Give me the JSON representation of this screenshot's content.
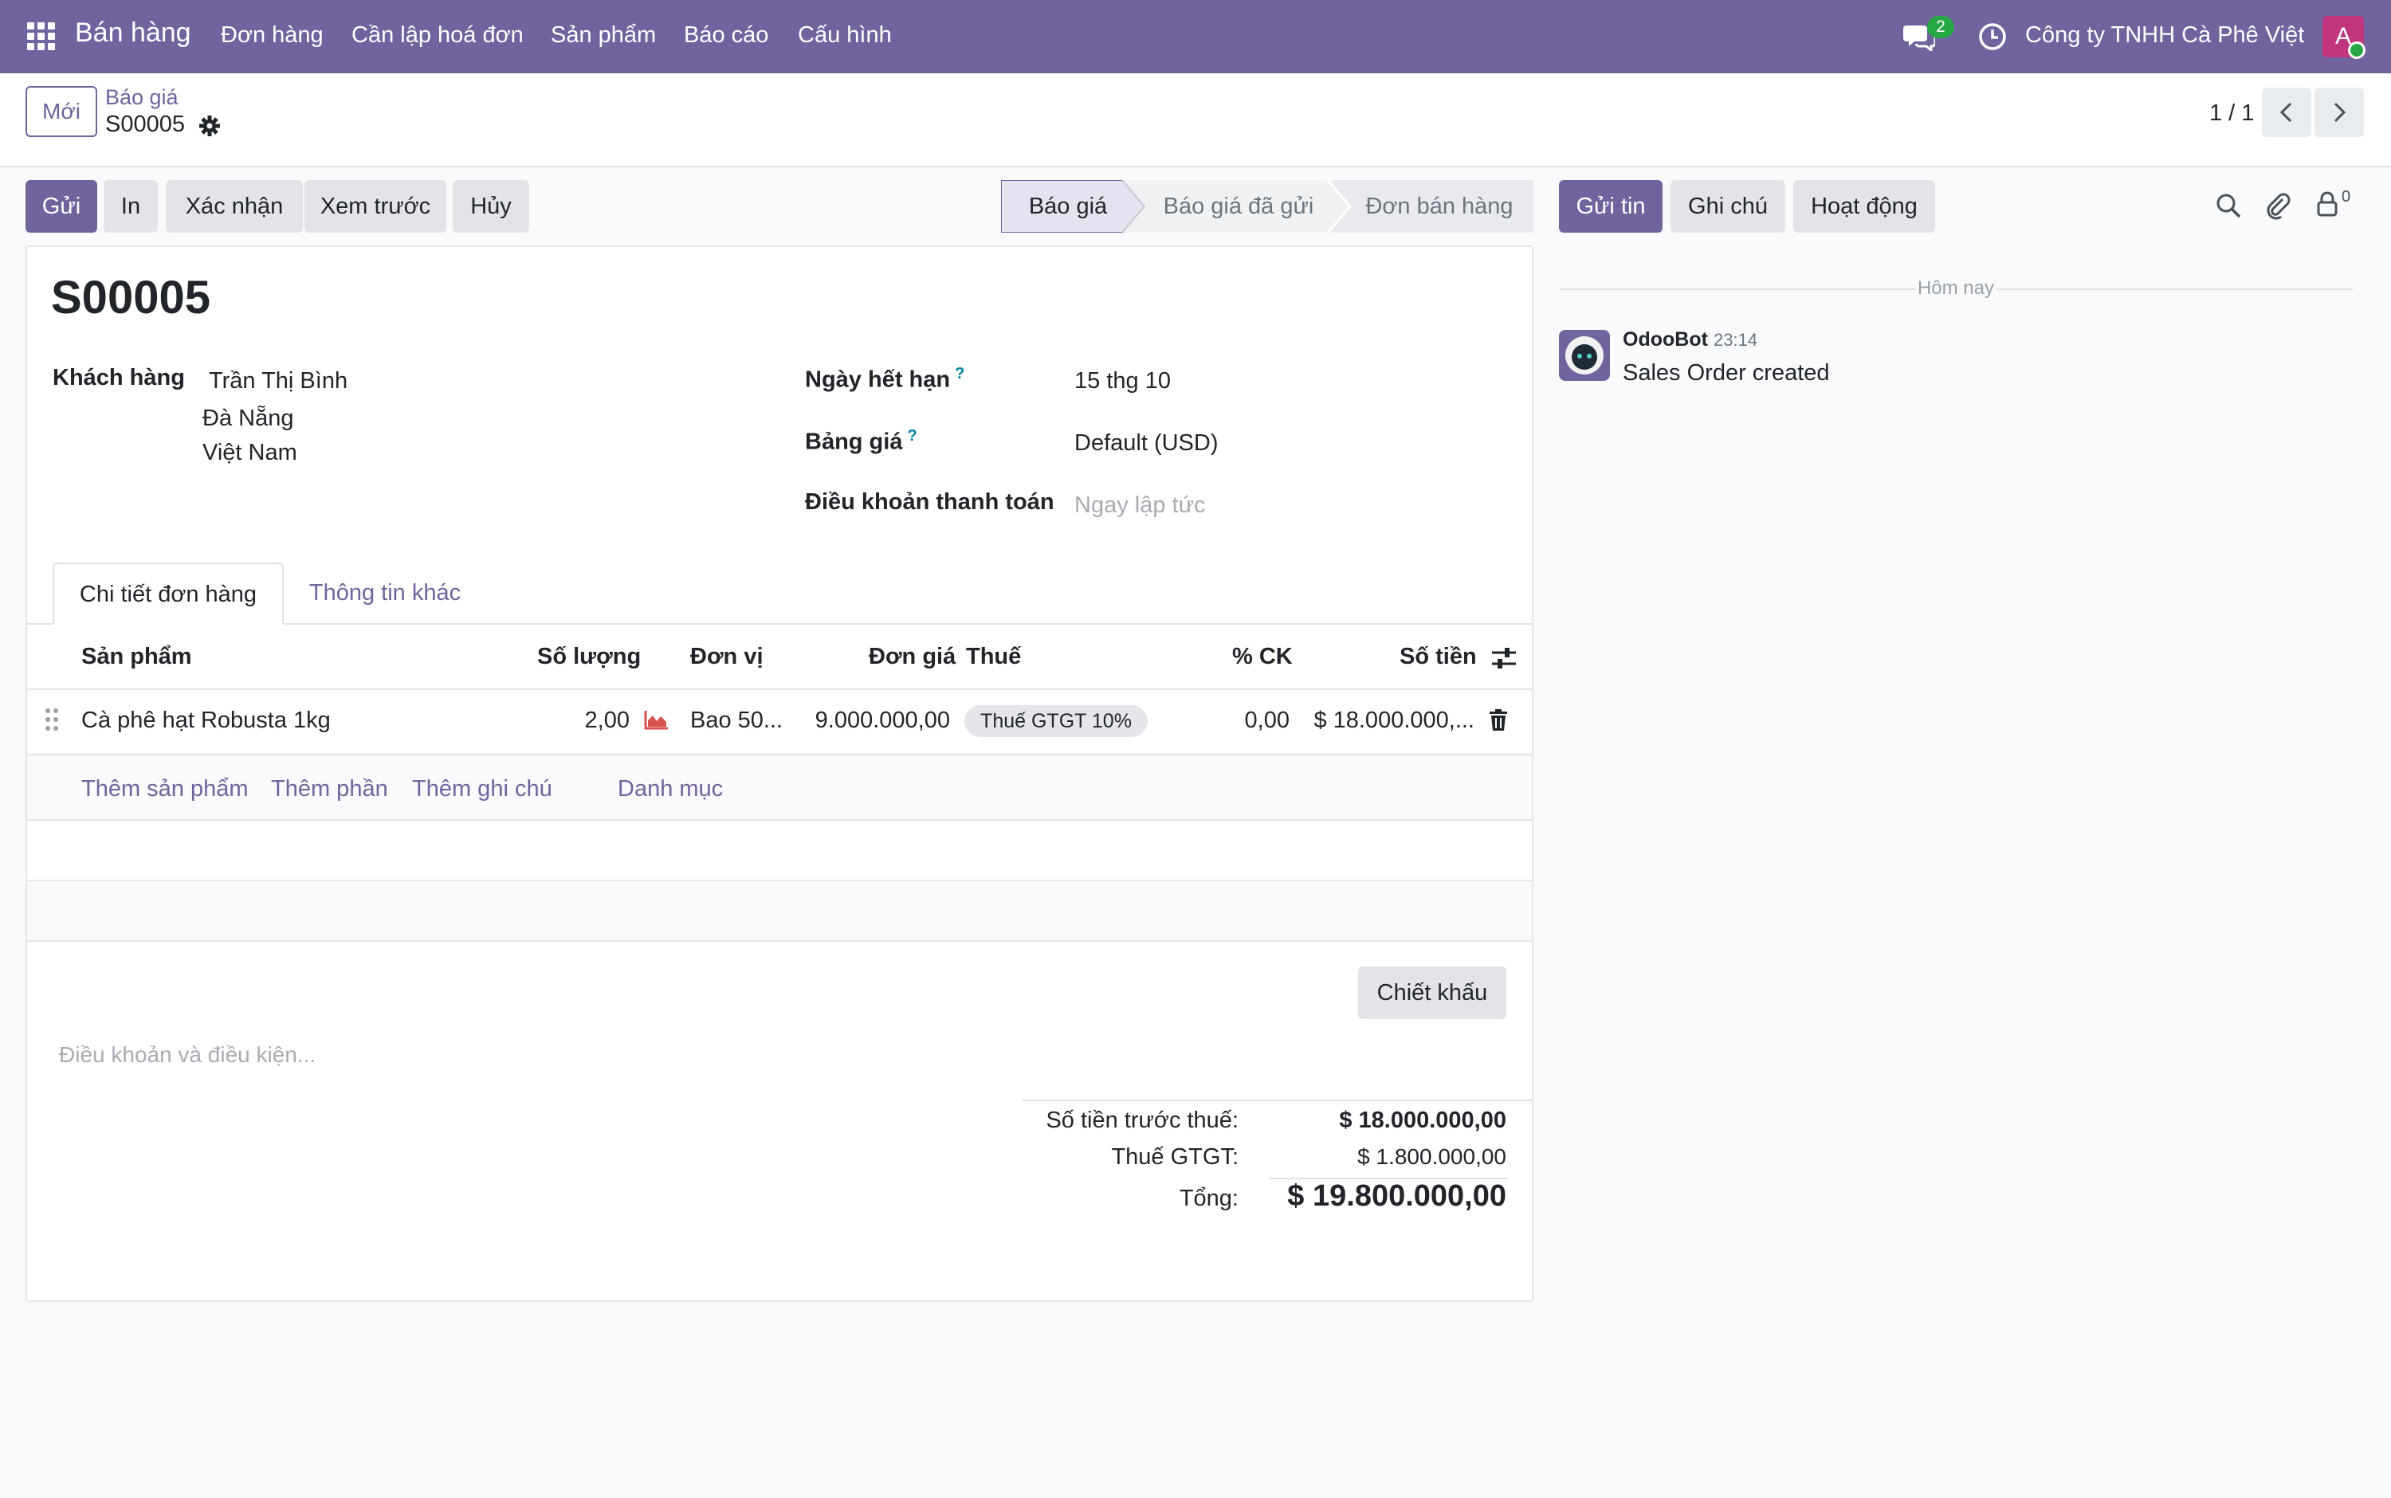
{
  "navbar": {
    "app_name": "Bán hàng",
    "menu": [
      "Đơn hàng",
      "Cần lập hoá đơn",
      "Sản phẩm",
      "Báo cáo",
      "Cấu hình"
    ],
    "messages_count": "2",
    "company": "Công ty TNHH Cà Phê Việt",
    "avatar_letter": "A"
  },
  "control_panel": {
    "new_button": "Mới",
    "breadcrumb_parent": "Báo giá",
    "breadcrumb_current": "S00005",
    "pager": "1 / 1"
  },
  "actions": {
    "send": "Gửi",
    "print": "In",
    "confirm": "Xác nhận",
    "preview": "Xem trước",
    "cancel": "Hủy"
  },
  "status_bar": {
    "steps": [
      "Báo giá",
      "Báo giá đã gửi",
      "Đơn bán hàng"
    ],
    "active": "Báo giá"
  },
  "form": {
    "title": "S00005",
    "customer_label": "Khách hàng",
    "customer_name": "Trần Thị Bình",
    "customer_city": "Đà Nẵng",
    "customer_country": "Việt Nam",
    "expiration_label": "Ngày hết hạn",
    "expiration_value": "15 thg 10",
    "pricelist_label": "Bảng giá",
    "pricelist_value": "Default (USD)",
    "payment_terms_label": "Điều khoản thanh toán",
    "payment_terms_placeholder": "Ngay lập tức",
    "help_mark": "?"
  },
  "tabs": [
    "Chi tiết đơn hàng",
    "Thông tin khác"
  ],
  "order_lines": {
    "columns": [
      "Sản phẩm",
      "Số lượng",
      "Đơn vị",
      "Đơn giá",
      "Thuế",
      "% CK",
      "Số tiền"
    ],
    "rows": [
      {
        "product": "Cà phê hạt Robusta 1kg",
        "quantity": "2,00",
        "unit": "Bao 50...",
        "unit_price": "9.000.000,00",
        "tax": "Thuế GTGT 10%",
        "discount": "0,00",
        "subtotal": "$ 18.000.000,..."
      }
    ],
    "add_links": [
      "Thêm sản phẩm",
      "Thêm phần",
      "Thêm ghi chú",
      "Danh mục"
    ]
  },
  "discount_button": "Chiết khấu",
  "terms_placeholder": "Điều khoản và điều kiện...",
  "totals": {
    "untaxed_label": "Số tiền trước thuế:",
    "untaxed_value": "$ 18.000.000,00",
    "tax_label": "Thuế GTGT:",
    "tax_value": "$ 1.800.000,00",
    "total_label": "Tổng:",
    "total_value": "$ 19.800.000,00"
  },
  "chatter": {
    "send_message": "Gửi tin",
    "log_note": "Ghi chú",
    "activities": "Hoạt động",
    "followers_count": "0",
    "date_separator": "Hôm nay",
    "messages": [
      {
        "author": "OdooBot",
        "time": "23:14",
        "body": "Sales Order created"
      }
    ]
  },
  "colors": {
    "brand": "#71639e",
    "navbar": "#71639e",
    "success": "#28a745",
    "avatar": "#c0357c"
  }
}
